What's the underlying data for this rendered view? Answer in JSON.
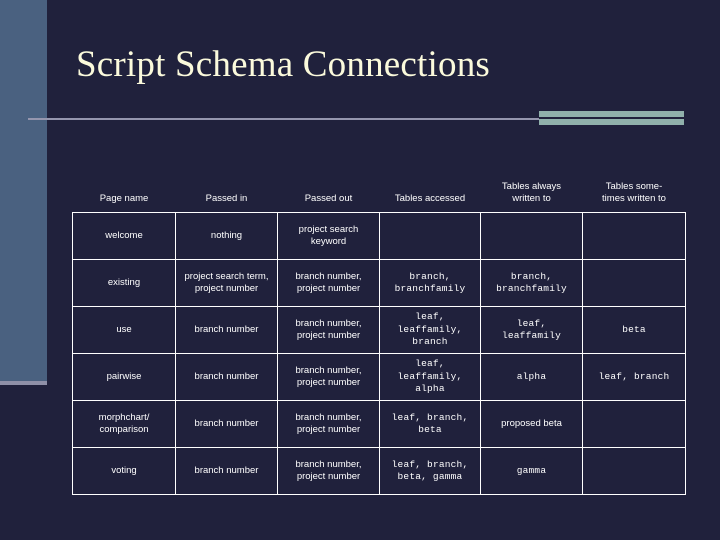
{
  "slide": {
    "title": "Script Schema Connections",
    "background_color": "#20213c",
    "title_color": "#fbfadc",
    "sidebar_color": "#4a6180",
    "accent_color": "#90b0ab",
    "rule_color": "#9596ae",
    "grid_color": "#ffffff"
  },
  "table": {
    "headers": [
      "Page name",
      "Passed in",
      "Passed out",
      "Tables accessed",
      "Tables always\nwritten to",
      "Tables some-\ntimes written to"
    ],
    "rows": [
      {
        "page_name": "welcome",
        "passed_in": "nothing",
        "passed_out": "project search\nkeyword",
        "tables_accessed": "",
        "tables_always_written_to": "",
        "tables_sometimes_written_to": ""
      },
      {
        "page_name": "existing",
        "passed_in": "project search term,\nproject number",
        "passed_out": "branch number,\nproject number",
        "tables_accessed": "branch,\nbranchfamily",
        "tables_always_written_to": "branch,\nbranchfamily",
        "tables_sometimes_written_to": ""
      },
      {
        "page_name": "use",
        "passed_in": "branch number",
        "passed_out": "branch number,\nproject number",
        "tables_accessed": "leaf,\nleaffamily,\nbranch",
        "tables_always_written_to": "leaf,\nleaffamily",
        "tables_sometimes_written_to": "beta"
      },
      {
        "page_name": "pairwise",
        "passed_in": "branch number",
        "passed_out": "branch number,\nproject number",
        "tables_accessed": "leaf,\nleaffamily,\nalpha",
        "tables_always_written_to": "alpha",
        "tables_sometimes_written_to": "leaf, branch"
      },
      {
        "page_name": "morphchart/\ncomparison",
        "passed_in": "branch number",
        "passed_out": "branch number,\nproject number",
        "tables_accessed": "leaf, branch,\nbeta",
        "tables_always_written_to": "proposed beta",
        "tables_sometimes_written_to": ""
      },
      {
        "page_name": "voting",
        "passed_in": "branch number",
        "passed_out": "branch number,\nproject number",
        "tables_accessed": "leaf, branch,\nbeta, gamma",
        "tables_always_written_to": "gamma",
        "tables_sometimes_written_to": ""
      }
    ]
  }
}
